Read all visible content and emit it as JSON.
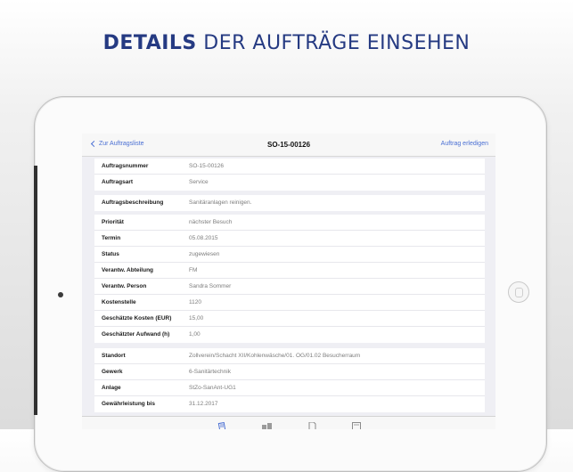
{
  "headline": {
    "bold": "DETAILS",
    "rest": " DER AUFTRÄGE EINSEHEN"
  },
  "navbar": {
    "back_label": "Zur Auftragsliste",
    "title": "SO-15-00126",
    "action_label": "Auftrag erledigen"
  },
  "groups": [
    [
      {
        "label": "Auftragsnummer",
        "value": "SO-15-00126"
      },
      {
        "label": "Auftragsart",
        "value": "Service"
      }
    ],
    [
      {
        "label": "Auftragsbeschreibung",
        "value": "Sanitäranlagen reinigen."
      }
    ],
    [
      {
        "label": "Priorität",
        "value": "nächster Besuch"
      },
      {
        "label": "Termin",
        "value": "05.08.2015"
      },
      {
        "label": "Status",
        "value": "zugewiesen"
      },
      {
        "label": "Verantw. Abteilung",
        "value": "FM"
      },
      {
        "label": "Verantw. Person",
        "value": "Sandra Sommer"
      },
      {
        "label": "Kostenstelle",
        "value": "1120"
      },
      {
        "label": "Geschätzte Kosten (EUR)",
        "value": "15,00"
      },
      {
        "label": "Geschätzter Aufwand (h)",
        "value": "1,00"
      }
    ],
    [
      {
        "label": "Standort",
        "value": "Zollverein/Schacht XII/Kohlenwäsche/01. OG/01.02 Besucherraum"
      },
      {
        "label": "Gewerk",
        "value": "6-Sanitärtechnik"
      },
      {
        "label": "Anlage",
        "value": "StZo-SanAnt-UG1"
      },
      {
        "label": "Gewährleistung bis",
        "value": "31.12.2017"
      }
    ]
  ],
  "tabs": [
    {
      "icon": "details-icon"
    },
    {
      "icon": "objects-icon"
    },
    {
      "icon": "document-icon"
    },
    {
      "icon": "notes-icon"
    }
  ],
  "colors": {
    "headline": "#253a82",
    "accent": "#4a6fd3"
  }
}
